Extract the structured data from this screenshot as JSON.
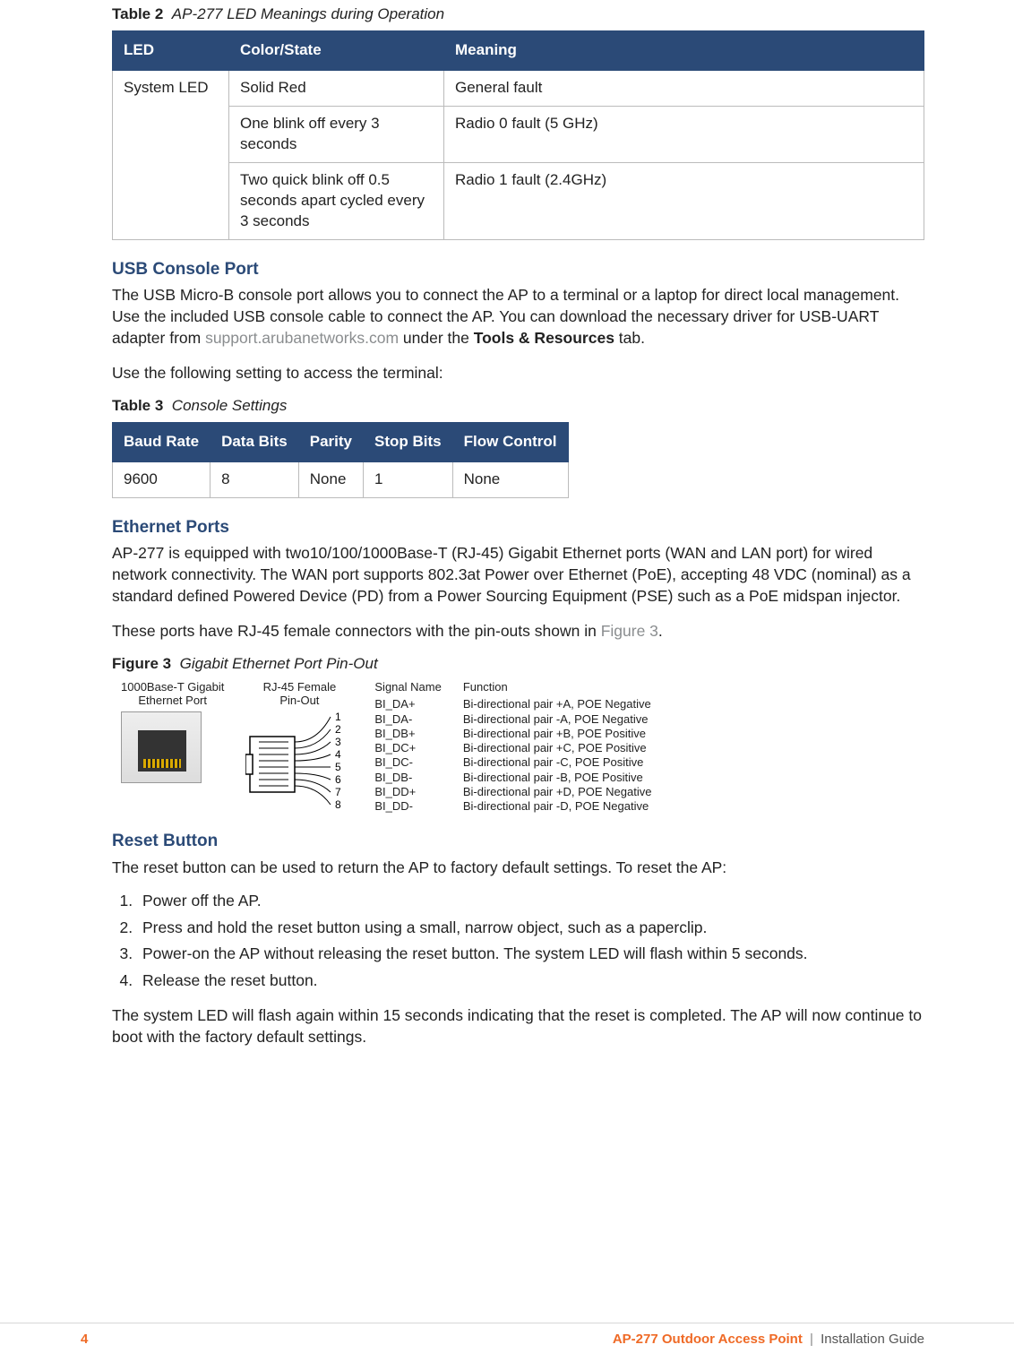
{
  "table2": {
    "caption_bold": "Table 2",
    "caption_italic": "AP-277 LED Meanings during Operation",
    "headers": {
      "c1": "LED",
      "c2": "Color/State",
      "c3": "Meaning"
    },
    "row1": {
      "led": "System LED",
      "state": "Solid Red",
      "meaning": "General fault"
    },
    "row2": {
      "state": "One blink off every 3 seconds",
      "meaning": "Radio 0 fault (5 GHz)"
    },
    "row3": {
      "state": "Two quick blink off 0.5 seconds apart cycled every 3 seconds",
      "meaning": "Radio 1 fault (2.4GHz)"
    }
  },
  "usb": {
    "heading": "USB Console Port",
    "p1a": "The USB Micro-B console port allows you to connect the AP to a terminal or a laptop for direct local management. Use the included USB console cable to connect the AP. You can download the necessary driver for USB-UART adapter from ",
    "link": "support.arubanetworks.com",
    "p1b": " under the ",
    "bold": "Tools & Resources",
    "p1c": " tab.",
    "p2": "Use the following setting to access the terminal:"
  },
  "table3": {
    "caption_bold": "Table 3",
    "caption_italic": "Console Settings",
    "headers": {
      "c1": "Baud Rate",
      "c2": "Data Bits",
      "c3": "Parity",
      "c4": "Stop Bits",
      "c5": "Flow Control"
    },
    "row": {
      "c1": "9600",
      "c2": "8",
      "c3": "None",
      "c4": "1",
      "c5": "None"
    }
  },
  "eth": {
    "heading": "Ethernet Ports",
    "p1": "AP-277 is equipped with two10/100/1000Base-T (RJ-45) Gigabit Ethernet ports (WAN and LAN port) for wired network connectivity. The WAN port supports 802.3at Power over Ethernet (PoE), accepting 48 VDC (nominal) as a standard defined Powered Device (PD) from a Power Sourcing Equipment (PSE) such as a PoE midspan injector.",
    "p2a": "These ports have RJ-45 female connectors with the pin-outs shown in ",
    "fig_link": "Figure 3",
    "p2b": "."
  },
  "figure3": {
    "caption_bold": "Figure 3",
    "caption_italic": "Gigabit Ethernet Port Pin-Out",
    "col1_title": "1000Base-T Gigabit\nEthernet Port",
    "col2_title": "RJ-45 Female\nPin-Out",
    "col3_title": "Signal Name",
    "col4_title": "Function",
    "pins": {
      "p1": {
        "n": "1",
        "sig": "BI_DA+",
        "fn": "Bi-directional pair +A, POE Negative"
      },
      "p2": {
        "n": "2",
        "sig": "BI_DA-",
        "fn": "Bi-directional pair -A, POE Negative"
      },
      "p3": {
        "n": "3",
        "sig": "BI_DB+",
        "fn": "Bi-directional pair +B, POE Positive"
      },
      "p4": {
        "n": "4",
        "sig": "BI_DC+",
        "fn": "Bi-directional pair +C, POE Positive"
      },
      "p5": {
        "n": "5",
        "sig": "BI_DC-",
        "fn": "Bi-directional pair -C, POE Positive"
      },
      "p6": {
        "n": "6",
        "sig": "BI_DB-",
        "fn": "Bi-directional pair -B, POE Positive"
      },
      "p7": {
        "n": "7",
        "sig": "BI_DD+",
        "fn": "Bi-directional pair +D, POE Negative"
      },
      "p8": {
        "n": "8",
        "sig": "BI_DD-",
        "fn": "Bi-directional pair -D, POE Negative"
      }
    }
  },
  "reset": {
    "heading": "Reset Button",
    "p1": "The reset button can be used to return the AP to factory default settings. To reset the AP:",
    "steps": {
      "s1": "Power off the AP.",
      "s2": "Press and hold the reset button using a small, narrow object, such as a paperclip.",
      "s3": "Power-on the AP without releasing the reset button. The system LED will flash within 5 seconds.",
      "s4": "Release the reset button."
    },
    "p2": "The system LED will flash again within 15 seconds indicating that the reset is completed. The AP will now continue to boot with the factory default settings."
  },
  "footer": {
    "page": "4",
    "doc": "AP-277 Outdoor Access Point",
    "pipe": "|",
    "guide": "Installation Guide"
  }
}
